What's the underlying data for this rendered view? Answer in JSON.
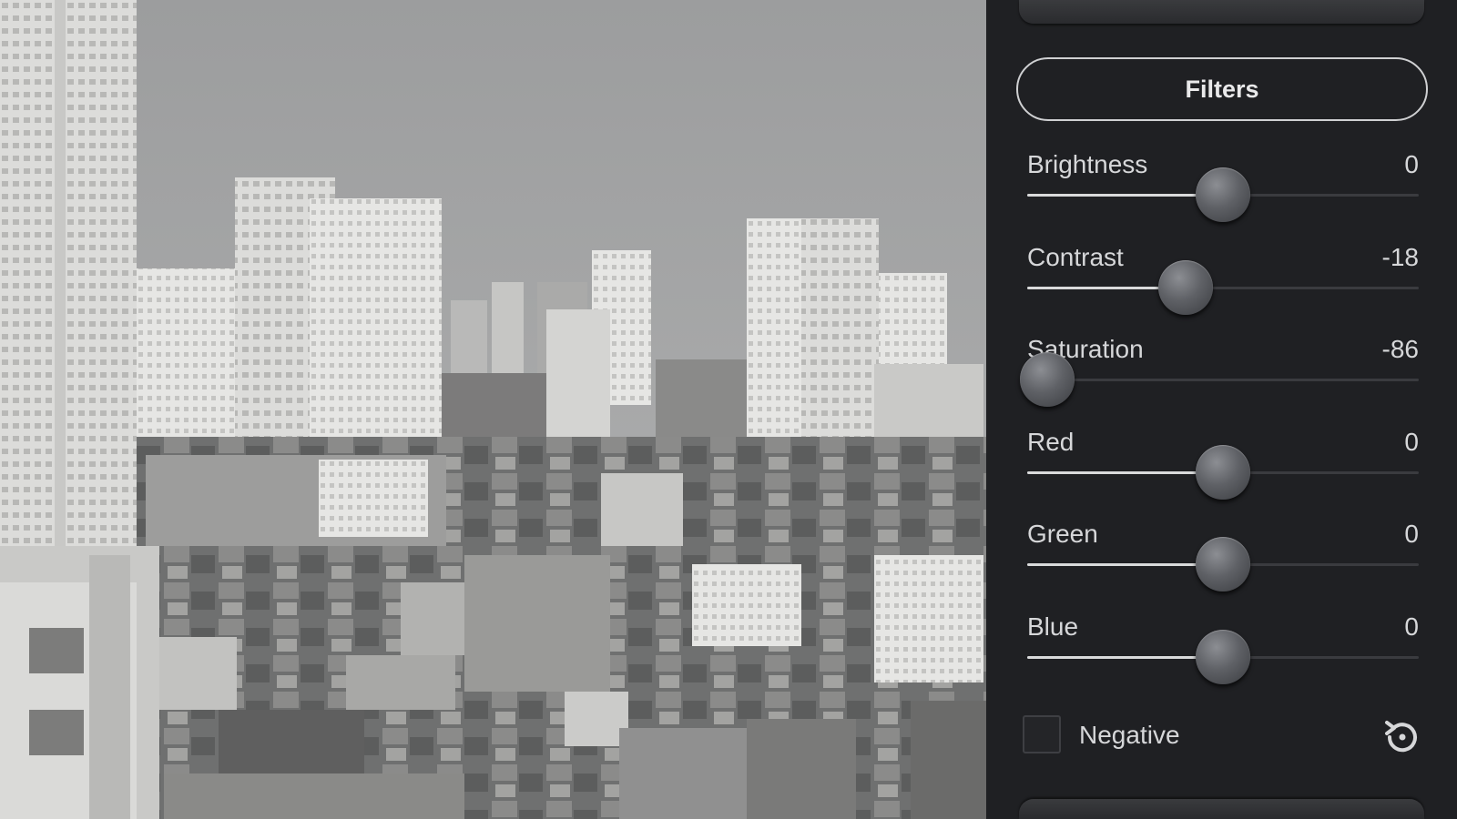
{
  "panel": {
    "filters_button": "Filters",
    "sliders": [
      {
        "label": "Brightness",
        "value": "0",
        "position": 0.5
      },
      {
        "label": "Contrast",
        "value": "-18",
        "position": 0.405
      },
      {
        "label": "Saturation",
        "value": "-86",
        "position": 0.05
      },
      {
        "label": "Red",
        "value": "0",
        "position": 0.5
      },
      {
        "label": "Green",
        "value": "0",
        "position": 0.5
      },
      {
        "label": "Blue",
        "value": "0",
        "position": 0.5
      }
    ],
    "negative": {
      "label": "Negative",
      "checked": false
    },
    "reset_icon": "reset-icon"
  },
  "colors": {
    "panel_bg": "#1f2023",
    "text": "#d6d7d9",
    "track": "#3a3b3f",
    "track_fill": "#d9dadb"
  }
}
